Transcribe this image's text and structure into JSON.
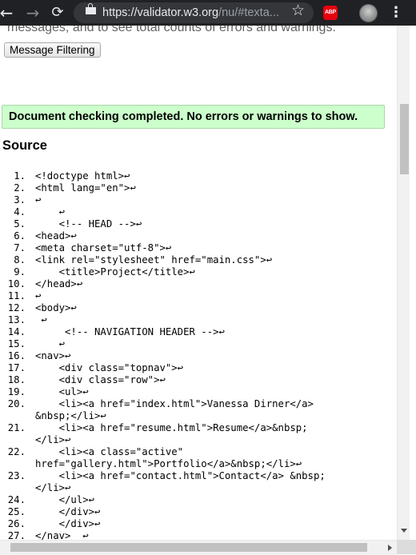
{
  "browser": {
    "url_host": "https://validator.w3.org",
    "url_path": "/nu/#texta...",
    "abp_label": "ABP",
    "icons": [
      "back-arrow-icon",
      "forward-arrow-icon",
      "reload-icon",
      "lock-icon",
      "star-icon",
      "adblock-icon",
      "profile-avatar",
      "menu-dots-icon"
    ]
  },
  "page": {
    "cutoff_text": "messages, and to see total counts of errors and warnings.",
    "filter_button": "Message Filtering",
    "success_message": "Document checking completed. No errors or warnings to show.",
    "source_heading": "Source"
  },
  "colors": {
    "success_bg": "#ccffcc",
    "chrome_bg": "#202124"
  },
  "source_lines": [
    {
      "n": "1.",
      "t": "<!doctype html>↩"
    },
    {
      "n": "2.",
      "t": "<html lang=\"en\">↩"
    },
    {
      "n": "3.",
      "t": "↩"
    },
    {
      "n": "4.",
      "t": "    ↩"
    },
    {
      "n": "5.",
      "t": "    <!-- HEAD -->↩"
    },
    {
      "n": "6.",
      "t": "<head>↩"
    },
    {
      "n": "7.",
      "t": "<meta charset=\"utf-8\">↩"
    },
    {
      "n": "8.",
      "t": "<link rel=\"stylesheet\" href=\"main.css\">↩"
    },
    {
      "n": "9.",
      "t": "    <title>Project</title>↩"
    },
    {
      "n": "10.",
      "t": "</head>↩"
    },
    {
      "n": "11.",
      "t": "↩"
    },
    {
      "n": "12.",
      "t": "<body>↩"
    },
    {
      "n": "13.",
      "t": " ↩"
    },
    {
      "n": "14.",
      "t": "     <!-- NAVIGATION HEADER -->↩"
    },
    {
      "n": "15.",
      "t": "    ↩"
    },
    {
      "n": "16.",
      "t": "<nav>↩"
    },
    {
      "n": "17.",
      "t": "    <div class=\"topnav\">↩"
    },
    {
      "n": "18.",
      "t": "    <div class=\"row\">↩"
    },
    {
      "n": "19.",
      "t": "    <ul>↩"
    },
    {
      "n": "20.",
      "t": "    <li><a href=\"index.html\">Vanessa Dirner</a>"
    },
    {
      "n": "",
      "t": "&nbsp;</li>↩"
    },
    {
      "n": "21.",
      "t": "    <li><a href=\"resume.html\">Resume</a>&nbsp;"
    },
    {
      "n": "",
      "t": "</li>↩"
    },
    {
      "n": "22.",
      "t": "    <li><a class=\"active\""
    },
    {
      "n": "",
      "t": "href=\"gallery.html\">Portfolio</a>&nbsp;</li>↩"
    },
    {
      "n": "23.",
      "t": "    <li><a href=\"contact.html\">Contact</a> &nbsp;"
    },
    {
      "n": "",
      "t": "</li>↩"
    },
    {
      "n": "24.",
      "t": "    </ul>↩"
    },
    {
      "n": "25.",
      "t": "    </div>↩"
    },
    {
      "n": "26.",
      "t": "    </div>↩"
    },
    {
      "n": "27.",
      "t": "</nav>  ↩"
    }
  ]
}
